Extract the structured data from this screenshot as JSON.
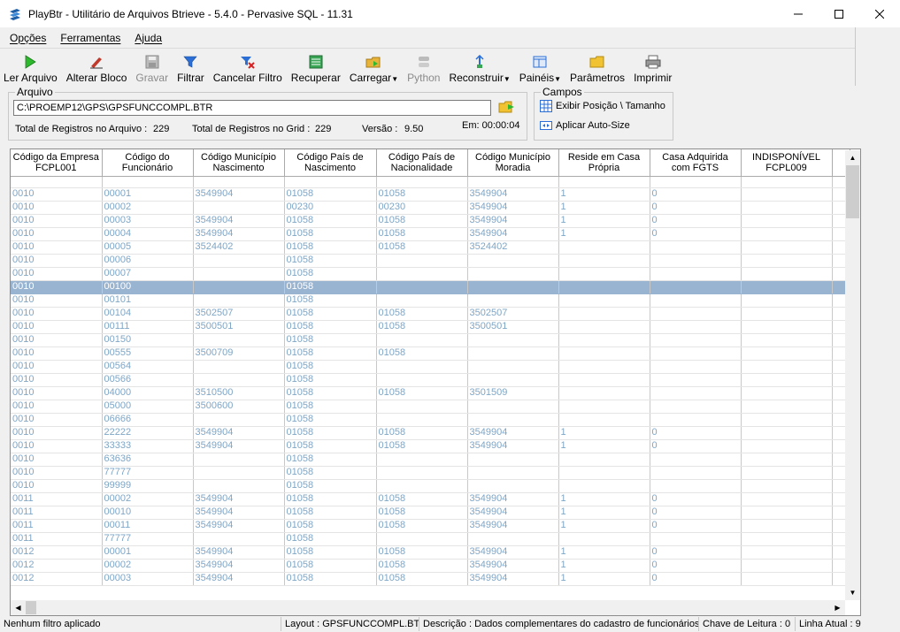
{
  "window": {
    "title": "PlayBtr - Utilitário de Arquivos Btrieve - 5.4.0 - Pervasive SQL - 11.31"
  },
  "menu": [
    "Opções",
    "Ferramentas",
    "Ajuda"
  ],
  "toolbar": {
    "ler_arquivo": "Ler Arquivo",
    "alterar_bloco": "Alterar Bloco",
    "gravar": "Gravar",
    "filtrar": "Filtrar",
    "cancelar_filtro": "Cancelar Filtro",
    "recuperar": "Recuperar",
    "carregar": "Carregar",
    "python": "Python",
    "reconstruir": "Reconstruir",
    "paineis": "Painéis",
    "parametros": "Parâmetros",
    "imprimir": "Imprimir"
  },
  "arquivo": {
    "legend": "Arquivo",
    "path": "C:\\PROEMP12\\GPS\\GPSFUNCCOMPL.BTR",
    "total_arquivo_label": "Total de Registros no Arquivo :",
    "total_arquivo_value": "229",
    "total_grid_label": "Total de Registros no Grid :",
    "total_grid_value": "229",
    "versao_label": "Versão :",
    "versao_value": "9.50",
    "em_label": "Em: 00:00:04"
  },
  "campos": {
    "legend": "Campos",
    "exibir": "Exibir Posição \\ Tamanho",
    "aplicar": "Aplicar Auto-Size"
  },
  "grid": {
    "columns": [
      "Código da Empresa FCPL001",
      "Código do Funcionário",
      "Código Município Nascimento",
      "Código País de Nascimento",
      "Código País de Nacionalidade",
      "Código Município Moradia",
      "Reside em Casa Própria",
      "Casa Adquirida com FGTS",
      "INDISPONÍVEL FCPL009"
    ],
    "selected_row": 8,
    "rows": [
      [
        "0010",
        "00001",
        "3549904",
        "01058",
        "01058",
        "3549904",
        "1",
        "0",
        ""
      ],
      [
        "0010",
        "00002",
        "",
        "00230",
        "00230",
        "3549904",
        "1",
        "0",
        ""
      ],
      [
        "0010",
        "00003",
        "3549904",
        "01058",
        "01058",
        "3549904",
        "1",
        "0",
        ""
      ],
      [
        "0010",
        "00004",
        "3549904",
        "01058",
        "01058",
        "3549904",
        "1",
        "0",
        ""
      ],
      [
        "0010",
        "00005",
        "3524402",
        "01058",
        "01058",
        "3524402",
        "",
        "",
        ""
      ],
      [
        "0010",
        "00006",
        "",
        "01058",
        "",
        "",
        "",
        "",
        ""
      ],
      [
        "0010",
        "00007",
        "",
        "01058",
        "",
        "",
        "",
        "",
        ""
      ],
      [
        "0010",
        "00100",
        "",
        "01058",
        "",
        "",
        "",
        "",
        ""
      ],
      [
        "0010",
        "00101",
        "",
        "01058",
        "",
        "",
        "",
        "",
        ""
      ],
      [
        "0010",
        "00104",
        "3502507",
        "01058",
        "01058",
        "3502507",
        "",
        "",
        ""
      ],
      [
        "0010",
        "00111",
        "3500501",
        "01058",
        "01058",
        "3500501",
        "",
        "",
        ""
      ],
      [
        "0010",
        "00150",
        "",
        "01058",
        "",
        "",
        "",
        "",
        ""
      ],
      [
        "0010",
        "00555",
        "3500709",
        "01058",
        "01058",
        "",
        "",
        "",
        ""
      ],
      [
        "0010",
        "00564",
        "",
        "01058",
        "",
        "",
        "",
        "",
        ""
      ],
      [
        "0010",
        "00566",
        "",
        "01058",
        "",
        "",
        "",
        "",
        ""
      ],
      [
        "0010",
        "04000",
        "3510500",
        "01058",
        "01058",
        "3501509",
        "",
        "",
        ""
      ],
      [
        "0010",
        "05000",
        "3500600",
        "01058",
        "",
        "",
        "",
        "",
        ""
      ],
      [
        "0010",
        "06666",
        "",
        "01058",
        "",
        "",
        "",
        "",
        ""
      ],
      [
        "0010",
        "22222",
        "3549904",
        "01058",
        "01058",
        "3549904",
        "1",
        "0",
        ""
      ],
      [
        "0010",
        "33333",
        "3549904",
        "01058",
        "01058",
        "3549904",
        "1",
        "0",
        ""
      ],
      [
        "0010",
        "63636",
        "",
        "01058",
        "",
        "",
        "",
        "",
        ""
      ],
      [
        "0010",
        "77777",
        "",
        "01058",
        "",
        "",
        "",
        "",
        ""
      ],
      [
        "0010",
        "99999",
        "",
        "01058",
        "",
        "",
        "",
        "",
        ""
      ],
      [
        "0011",
        "00002",
        "3549904",
        "01058",
        "01058",
        "3549904",
        "1",
        "0",
        ""
      ],
      [
        "0011",
        "00010",
        "3549904",
        "01058",
        "01058",
        "3549904",
        "1",
        "0",
        ""
      ],
      [
        "0011",
        "00011",
        "3549904",
        "01058",
        "01058",
        "3549904",
        "1",
        "0",
        ""
      ],
      [
        "0011",
        "77777",
        "",
        "01058",
        "",
        "",
        "",
        "",
        ""
      ],
      [
        "0012",
        "00001",
        "3549904",
        "01058",
        "01058",
        "3549904",
        "1",
        "0",
        ""
      ],
      [
        "0012",
        "00002",
        "3549904",
        "01058",
        "01058",
        "3549904",
        "1",
        "0",
        ""
      ],
      [
        "0012",
        "00003",
        "3549904",
        "01058",
        "01058",
        "3549904",
        "1",
        "0",
        ""
      ]
    ]
  },
  "status": {
    "filtro": "Nenhum filtro aplicado",
    "layout": "Layout : GPSFUNCCOMPL.BTR",
    "descricao": "Descrição : Dados complementares do cadastro de funcionários",
    "chave": "Chave de Leitura : 0",
    "linha": "Linha Atual : 9"
  },
  "colors": {
    "cell_text": "#7fa6c6",
    "selection": "#99b4d1"
  }
}
